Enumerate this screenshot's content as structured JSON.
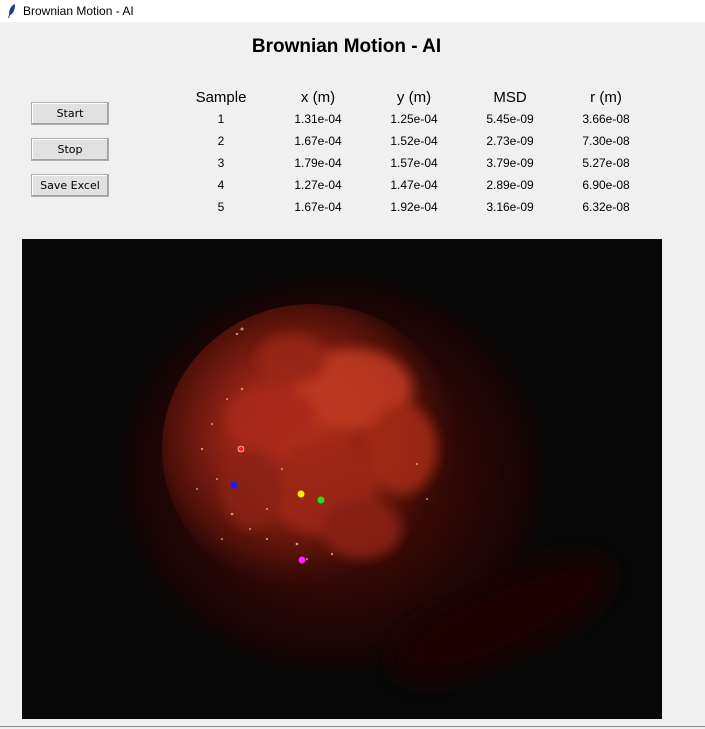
{
  "window": {
    "title": "Brownian Motion - AI",
    "icon": "feather-icon"
  },
  "heading": "Brownian Motion - AI",
  "buttons": {
    "start": "Start",
    "stop": "Stop",
    "save": "Save Excel"
  },
  "table": {
    "columns": [
      "Sample",
      "x (m)",
      "y (m)",
      "MSD",
      "r (m)"
    ],
    "rows": [
      [
        "1",
        "1.31e-04",
        "1.25e-04",
        "5.45e-09",
        "3.66e-08"
      ],
      [
        "2",
        "1.67e-04",
        "1.52e-04",
        "2.73e-09",
        "7.30e-08"
      ],
      [
        "3",
        "1.79e-04",
        "1.57e-04",
        "3.79e-09",
        "5.27e-08"
      ],
      [
        "4",
        "1.27e-04",
        "1.47e-04",
        "2.89e-09",
        "6.90e-08"
      ],
      [
        "5",
        "1.67e-04",
        "1.92e-04",
        "3.16e-09",
        "6.32e-08"
      ]
    ]
  },
  "markers": [
    {
      "color": "#ff2020"
    },
    {
      "color": "#1a1aff"
    },
    {
      "color": "#ffee00"
    },
    {
      "color": "#22dd22"
    },
    {
      "color": "#ff22ff"
    }
  ]
}
